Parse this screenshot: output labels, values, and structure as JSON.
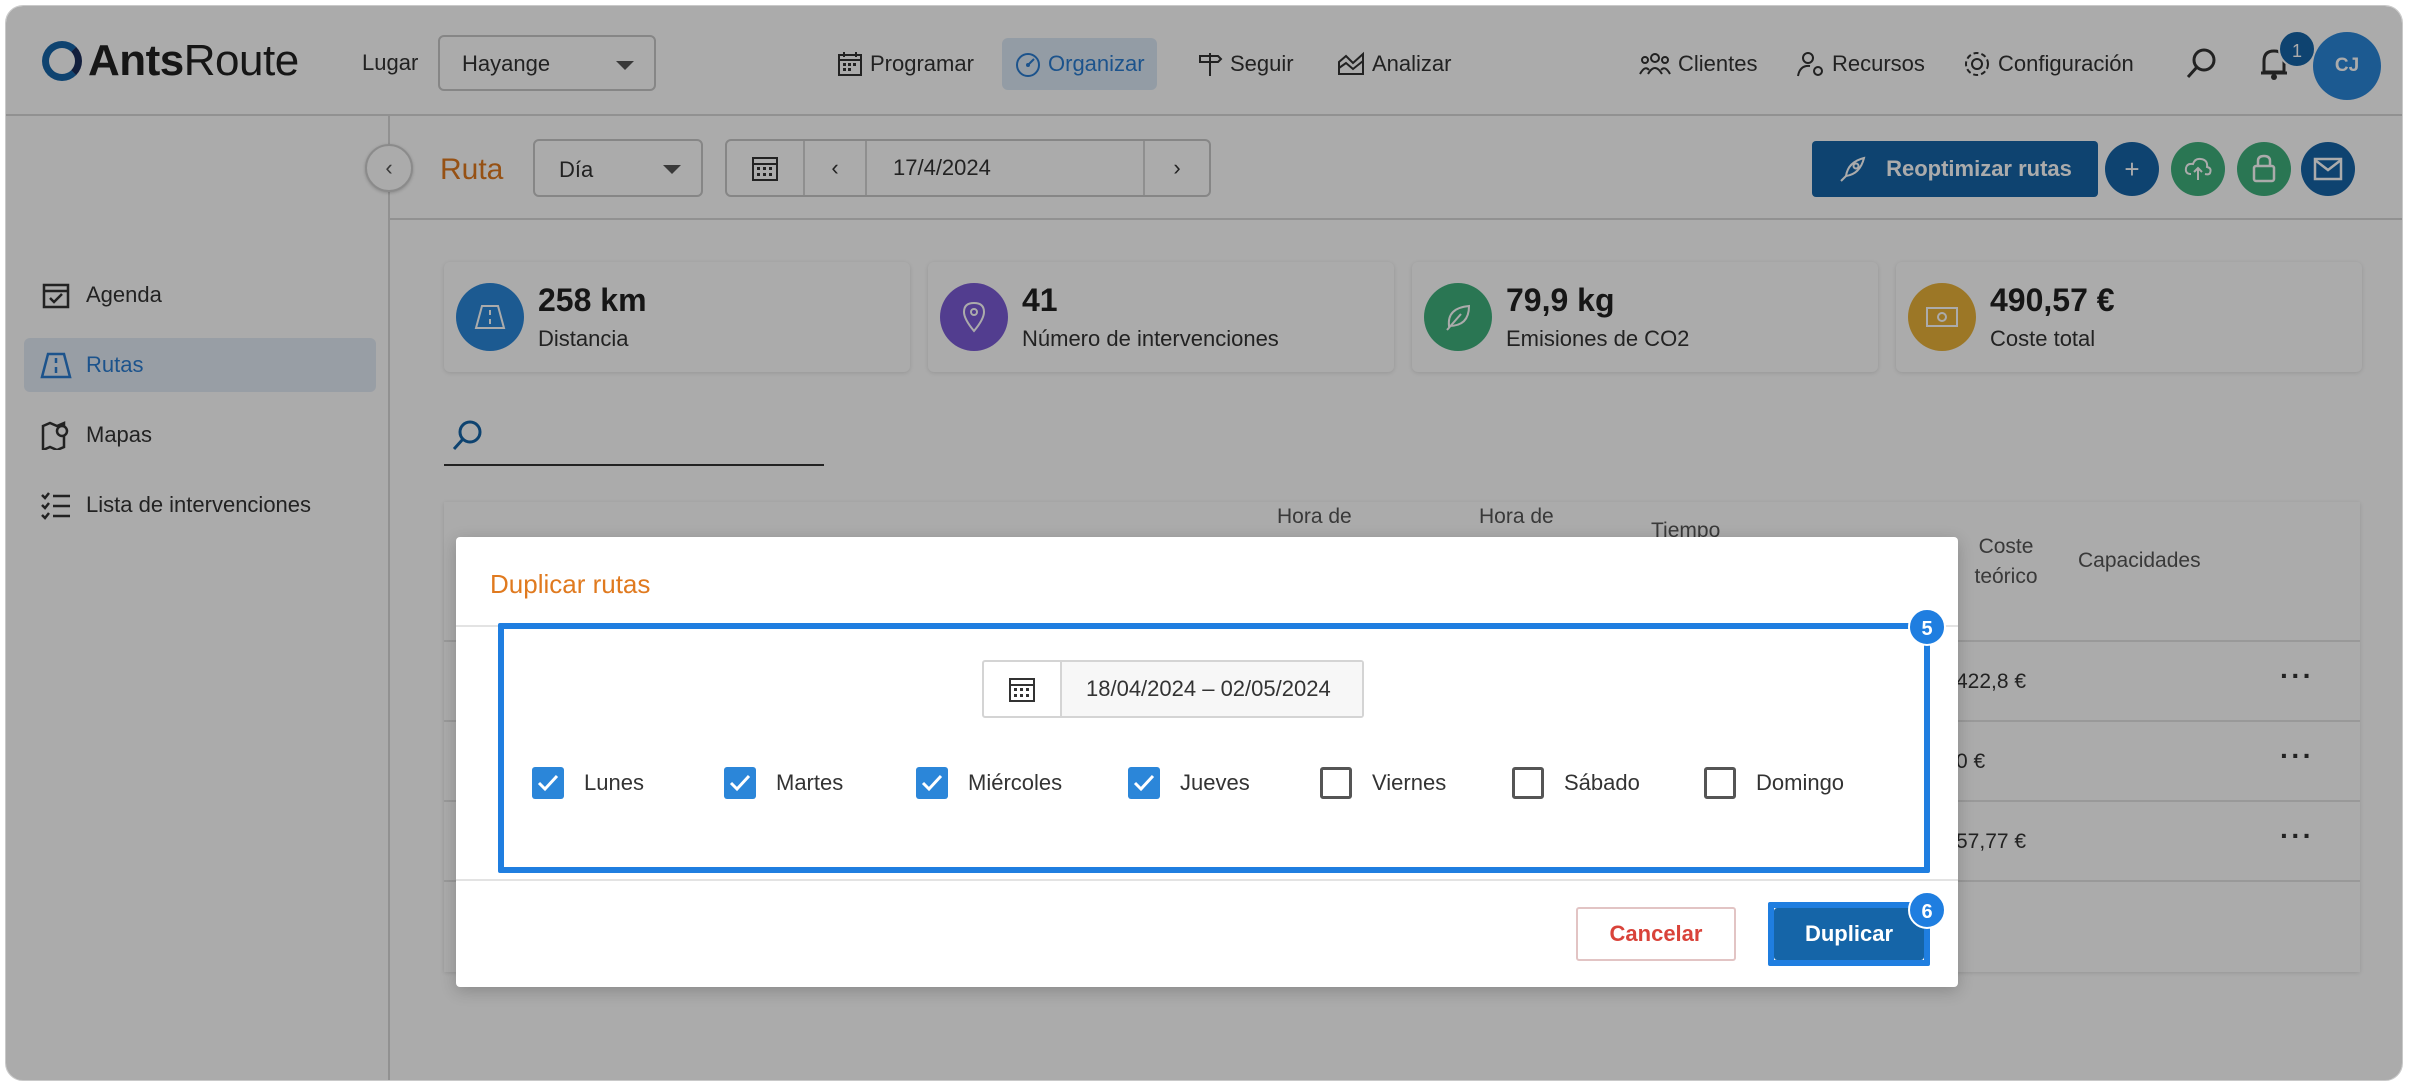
{
  "app": {
    "logo_bold": "Ants",
    "logo_light": "Route",
    "lugar_label": "Lugar",
    "lugar_value": "Hayange"
  },
  "nav": [
    {
      "label": "Programar",
      "icon": "calendar-grid-icon"
    },
    {
      "label": "Organizar",
      "icon": "speedometer-icon",
      "active": true
    },
    {
      "label": "Seguir",
      "icon": "signpost-icon"
    },
    {
      "label": "Analizar",
      "icon": "chart-area-icon"
    },
    {
      "label": "Clientes",
      "icon": "users-group-icon"
    },
    {
      "label": "Recursos",
      "icon": "user-gear-icon"
    },
    {
      "label": "Configuración",
      "icon": "gear-icon"
    }
  ],
  "header": {
    "notification_count": "1",
    "avatar_initials": "CJ"
  },
  "toolbar": {
    "title": "Ruta",
    "view_mode": "Día",
    "date": "17/4/2024",
    "reoptimize_label": "Reoptimizar rutas"
  },
  "sidebar": {
    "items": [
      {
        "label": "Agenda",
        "icon": "calendar-check-icon"
      },
      {
        "label": "Rutas",
        "icon": "road-icon",
        "active": true
      },
      {
        "label": "Mapas",
        "icon": "map-pin-icon"
      },
      {
        "label": "Lista de intervenciones",
        "icon": "checklist-icon"
      }
    ]
  },
  "kpis": [
    {
      "value": "258 km",
      "label": "Distancia",
      "color": "#2b86d9",
      "icon": "road-icon"
    },
    {
      "value": "41",
      "label": "Número de intervenciones",
      "color": "#7b5cd6",
      "icon": "location-pin-icon"
    },
    {
      "value": "79,9 kg",
      "label": "Emisiones de CO2",
      "color": "#3fb07d",
      "icon": "leaf-icon"
    },
    {
      "value": "490,57 €",
      "label": "Coste total",
      "color": "#e9b23a",
      "icon": "banknote-icon"
    }
  ],
  "table": {
    "headers": {
      "hora_inicio": "Hora de",
      "hora_fin": "Hora de",
      "tiempo": "Tiempo",
      "coste": "Coste teórico",
      "capacidades": "Capacidades"
    },
    "rows": [
      {
        "coste": "422,8 €"
      },
      {
        "coste": "0 €"
      },
      {
        "coste": "57,77 €"
      }
    ]
  },
  "modal": {
    "title": "Duplicar rutas",
    "date_range": "18/04/2024 – 02/05/2024",
    "days": [
      {
        "label": "Lunes",
        "checked": true
      },
      {
        "label": "Martes",
        "checked": true
      },
      {
        "label": "Miércoles",
        "checked": true
      },
      {
        "label": "Jueves",
        "checked": true
      },
      {
        "label": "Viernes",
        "checked": false
      },
      {
        "label": "Sábado",
        "checked": false
      },
      {
        "label": "Domingo",
        "checked": false
      }
    ],
    "cancel_label": "Cancelar",
    "duplicate_label": "Duplicar",
    "step_range": "5",
    "step_duplicate": "6"
  },
  "colors": {
    "brand": "#1565a8",
    "accent_orange": "#e07a1f",
    "highlight": "#1f7ee0",
    "checkbox": "#2b86d9"
  }
}
